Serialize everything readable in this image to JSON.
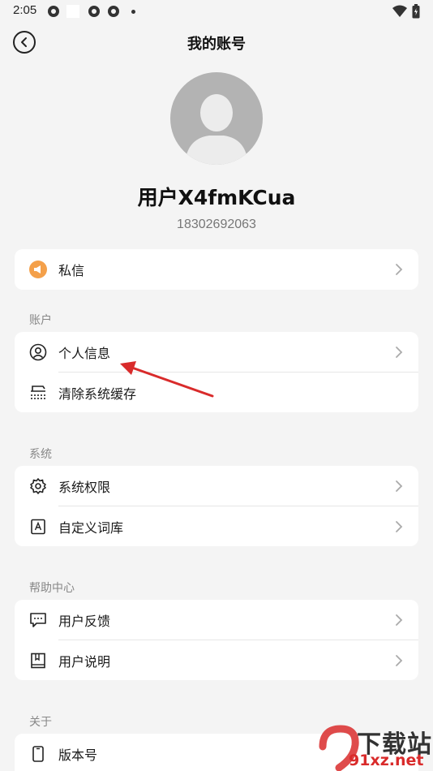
{
  "status_bar": {
    "time": "2:05"
  },
  "header": {
    "title": "我的账号"
  },
  "profile": {
    "name": "用户X4fmKCua",
    "phone": "18302692063"
  },
  "messages": {
    "label": "私信"
  },
  "sections": [
    {
      "title": "账户",
      "items": [
        {
          "label": "个人信息",
          "icon": "user-circle-icon"
        },
        {
          "label": "清除系统缓存",
          "icon": "clear-cache-icon"
        }
      ]
    },
    {
      "title": "系统",
      "items": [
        {
          "label": "系统权限",
          "icon": "gear-icon"
        },
        {
          "label": "自定义词库",
          "icon": "dictionary-icon"
        }
      ]
    },
    {
      "title": "帮助中心",
      "items": [
        {
          "label": "用户反馈",
          "icon": "feedback-icon"
        },
        {
          "label": "用户说明",
          "icon": "book-icon"
        }
      ]
    },
    {
      "title": "关于",
      "items": [
        {
          "label": "版本号",
          "icon": "phone-icon"
        }
      ]
    }
  ],
  "watermark": {
    "brand": "下载站",
    "url": "91xz.net"
  },
  "colors": {
    "accent_orange": "#f4a04a",
    "arrow_red": "#d92b2b"
  }
}
